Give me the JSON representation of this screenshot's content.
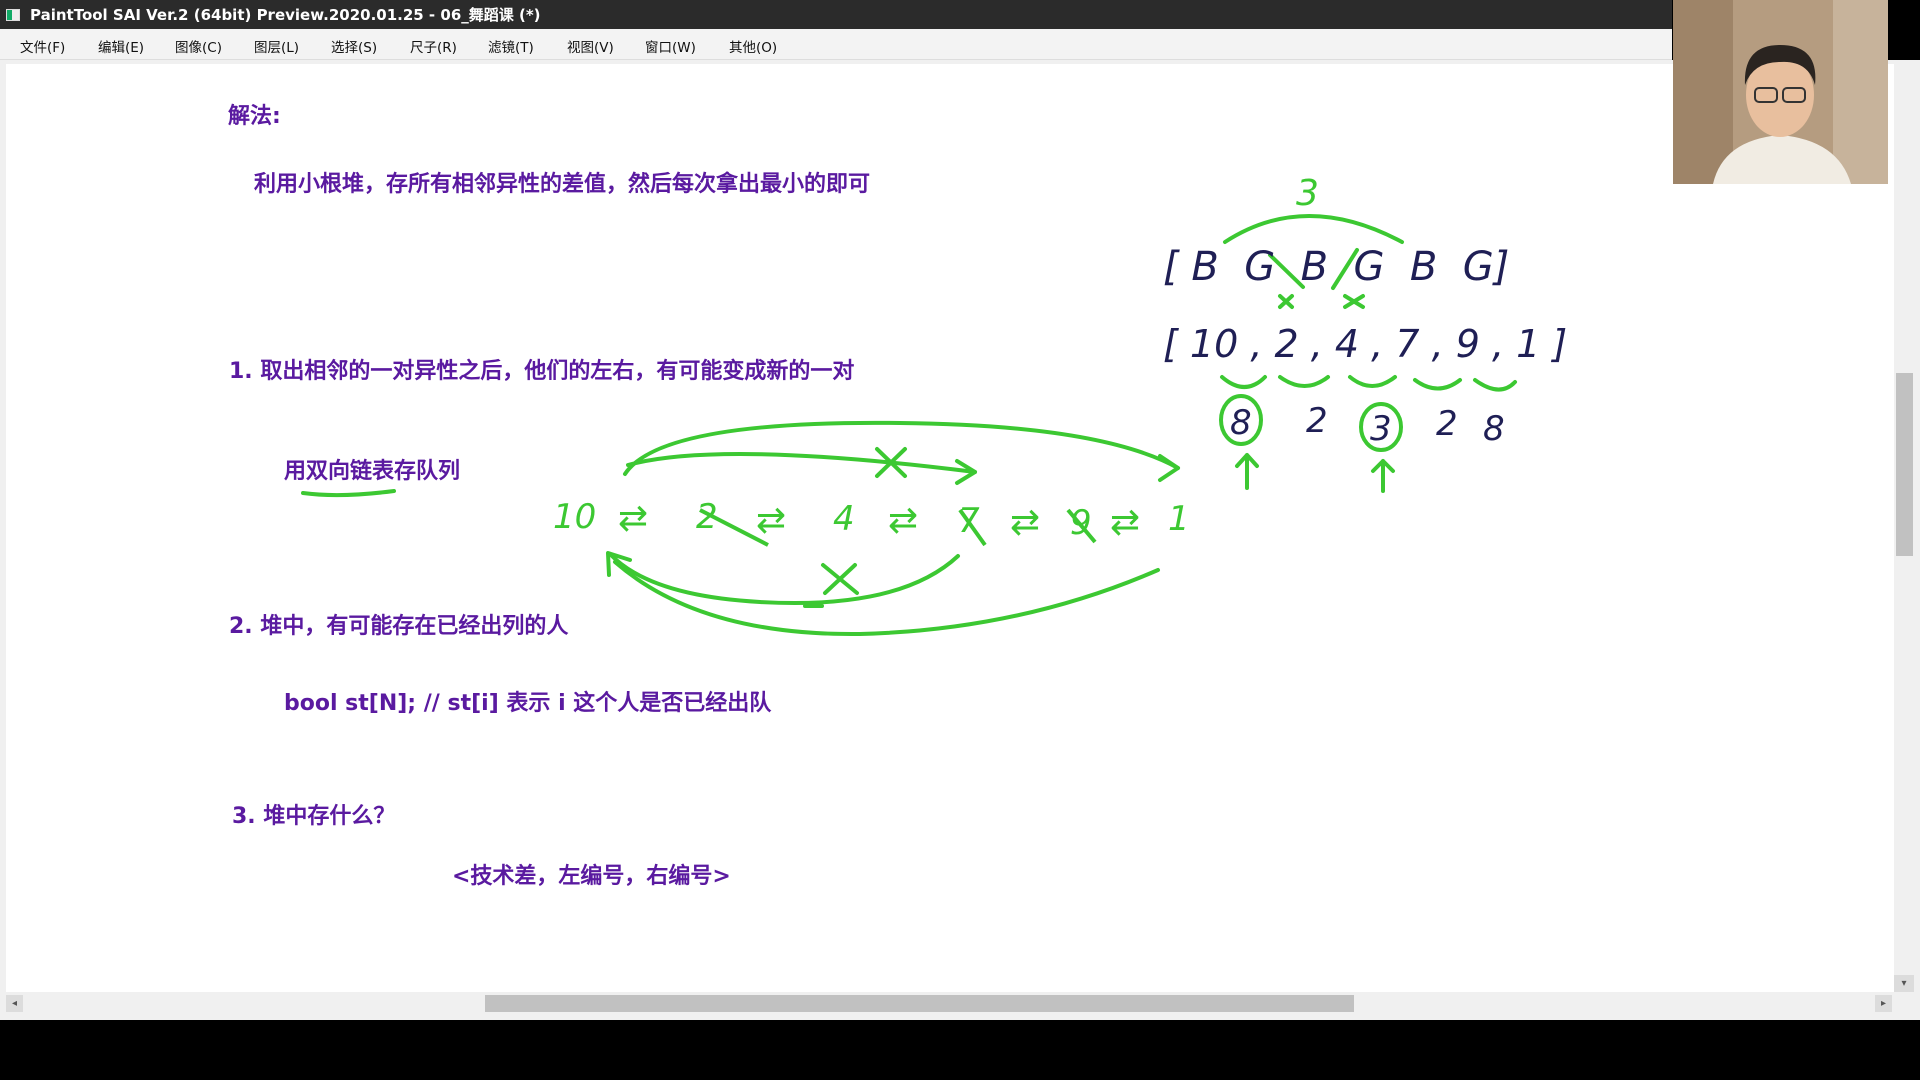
{
  "window": {
    "title": "PaintTool SAI Ver.2 (64bit) Preview.2020.01.25 - 06_舞蹈课 (*)"
  },
  "menu": {
    "items": [
      "文件(F)",
      "编辑(E)",
      "图像(C)",
      "图层(L)",
      "选择(S)",
      "尺子(R)",
      "滤镜(T)",
      "视图(V)",
      "窗口(W)",
      "其他(O)"
    ]
  },
  "notes": {
    "heading": "解法:",
    "approach": "利用小根堆，存所有相邻异性的差值，然后每次拿出最小的即可",
    "point1": "1. 取出相邻的一对异性之后，他们的左右，有可能变成新的一对",
    "point1_sub": "用双向链表存队列",
    "point2": "2. 堆中，有可能存在已经出列的人",
    "point2_sub": "bool st[N];  // st[i] 表示 i 这个人是否已经出队",
    "point3": "3. 堆中存什么？",
    "point3_sub": "<技术差，左编号，右编号>"
  },
  "handwriting": {
    "top_diff": "3",
    "gender_row": "[ B  G  B  G  B  G]",
    "skill_row": "[ 10 , 2 , 4 , 7 , 9 , 1 ]",
    "diffs": [
      "8",
      "2",
      "3",
      "2",
      "8"
    ],
    "linked_list": [
      "10",
      "⇄",
      "2",
      "⇄",
      "4",
      "⇄",
      "7",
      "⇄",
      "9",
      "⇄",
      "1"
    ],
    "ink_color": "#3cc832"
  },
  "colors": {
    "note_text": "#5a1aa0",
    "titlebar": "#2b2b2b",
    "menubar": "#f3f3f3"
  },
  "icons": {
    "app": "painttool-sai-icon",
    "scroll_left": "◂",
    "scroll_right": "▸",
    "scroll_down": "▾"
  }
}
